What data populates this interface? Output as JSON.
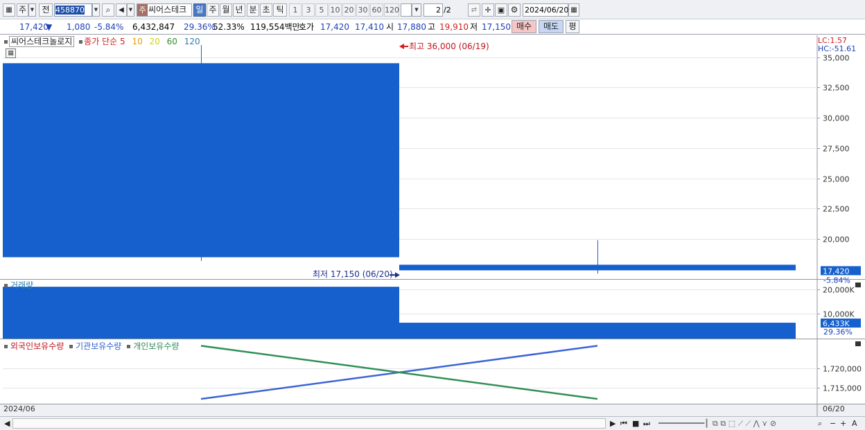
{
  "toolbar": {
    "market_label": "주",
    "prev_label": "전",
    "stock_code": "458870",
    "stock_name": "씨어스테크",
    "stock_badge": "주",
    "periods": [
      "일",
      "주",
      "월",
      "년",
      "분",
      "초",
      "틱"
    ],
    "active_period": "일",
    "intervals": [
      "1",
      "3",
      "5",
      "10",
      "20",
      "30",
      "60",
      "120"
    ],
    "page_current": "2",
    "page_total": "/2",
    "date": "2024/06/20"
  },
  "quote": {
    "price": "17,420",
    "change_arrow": "▼",
    "change": "1,080",
    "change_pct": "-5.84%",
    "volume": "6,432,847",
    "turnover_pct": "29.36%",
    "ratio_pct": "52.33%",
    "amount": "119,554백만",
    "hoga_label": "호가",
    "ask": "17,420",
    "bid": "17,410",
    "open_label": "시",
    "open": "17,880",
    "high_label": "고",
    "high": "19,910",
    "low_label": "저",
    "low": "17,150",
    "buy_label": "매수",
    "sell_label": "매도",
    "avg_label": "평"
  },
  "price_legend": {
    "title": "씨어스테크놀로지",
    "indicator": "종가 단순",
    "ma": [
      {
        "label": "5",
        "color": "#d21d1d"
      },
      {
        "label": "10",
        "color": "#e6a000"
      },
      {
        "label": "20",
        "color": "#cfd500"
      },
      {
        "label": "60",
        "color": "#2e8b2e"
      },
      {
        "label": "120",
        "color": "#2b7fae"
      }
    ]
  },
  "volume_legend": "거래량",
  "holdings_legend": [
    {
      "label": "외국인보유수량",
      "color": "#c0141c"
    },
    {
      "label": "기관보유수량",
      "color": "#2f5fd0"
    },
    {
      "label": "개인보유수량",
      "color": "#2e8b57"
    }
  ],
  "right_info": {
    "lc": "LC:1.57",
    "hc": "HC:-51.61"
  },
  "colors": {
    "candle_down": "#1560cc",
    "up": "#d21d1d",
    "institution": "#3b64d6",
    "individual": "#2f8f55"
  },
  "chart_data": [
    {
      "type": "candlestick",
      "pane": "price",
      "categories": [
        "06/19",
        "06/20"
      ],
      "series": [
        {
          "open": [
            34500,
            17880
          ],
          "high": [
            36000,
            19910
          ],
          "low": [
            18200,
            17150
          ],
          "close": [
            18500,
            17420
          ]
        }
      ],
      "yticks": [
        "35,000",
        "32,500",
        "30,000",
        "27,500",
        "25,000",
        "22,500",
        "20,000"
      ],
      "ytick_values": [
        35000,
        32500,
        30000,
        27500,
        25000,
        22500,
        20000
      ],
      "ylim": [
        16700,
        36800
      ],
      "current_price": "17,420",
      "current_change": "-5.84%",
      "current_value": 17420,
      "annotations": [
        {
          "text": "최고 36,000 (06/19)",
          "value": 36000
        },
        {
          "text": "최저 17,150 (06/20)",
          "value": 17150
        }
      ]
    },
    {
      "type": "bar",
      "pane": "volume",
      "categories": [
        "06/19",
        "06/20"
      ],
      "values": [
        21000000,
        6432847
      ],
      "yticks": [
        "20,000K",
        "10,000K"
      ],
      "ytick_values": [
        20000000,
        10000000
      ],
      "ylim": [
        0,
        23000000
      ],
      "current_label": "6,433K",
      "current_pct": "29.36%",
      "current_value": 6433000
    },
    {
      "type": "line",
      "pane": "holdings",
      "categories": [
        "06/19",
        "06/20"
      ],
      "series": [
        {
          "name": "기관보유수량",
          "values": [
            1712200,
            1725700
          ]
        },
        {
          "name": "개인보유수량",
          "values": [
            1725700,
            1712200
          ]
        }
      ],
      "yticks": [
        "1,720,000",
        "1,715,000"
      ],
      "ytick_values": [
        1720000,
        1715000
      ],
      "ylim": [
        1711000,
        1727000
      ]
    }
  ],
  "x_axis": {
    "left_label": "2024/06",
    "right_label": "06/20"
  }
}
